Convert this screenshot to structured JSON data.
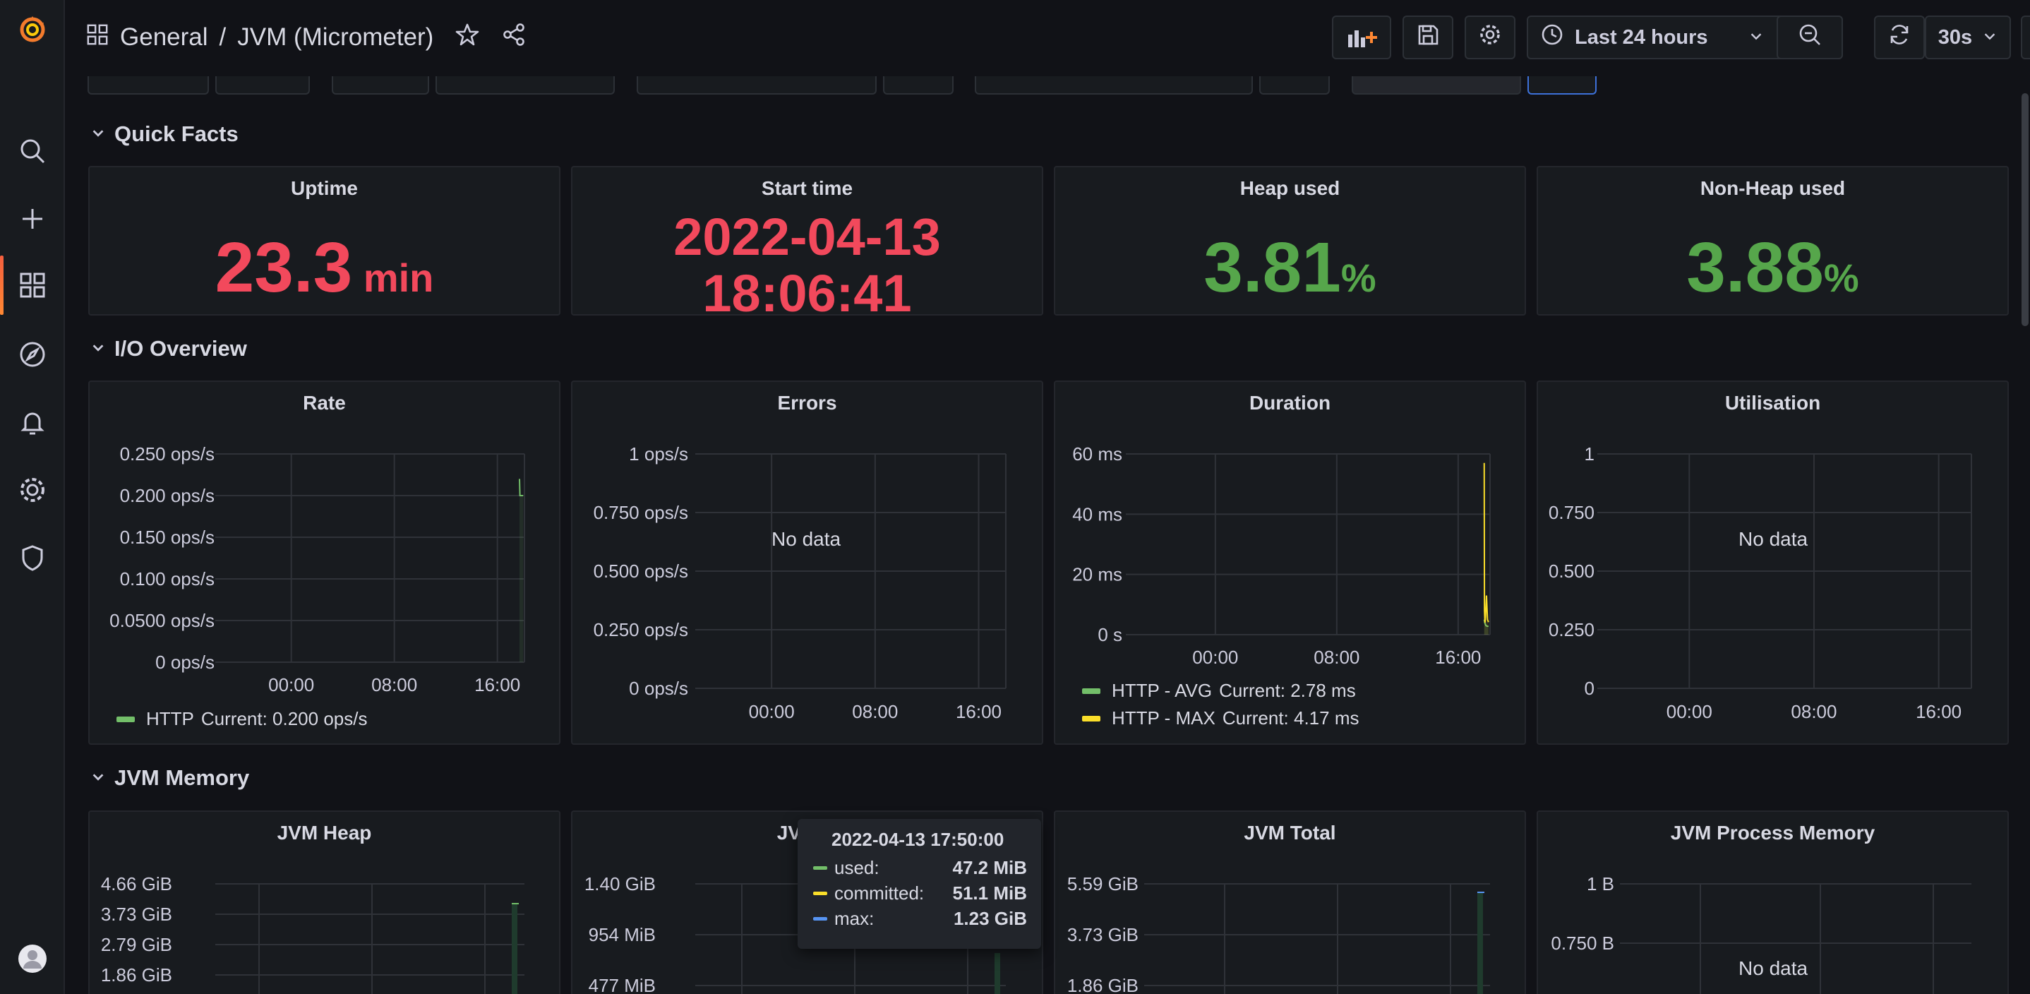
{
  "breadcrumb": {
    "folder": "General",
    "separator": "/",
    "dashboard": "JVM (Micrometer)"
  },
  "toolbar": {
    "time_range": "Last 24 hours",
    "refresh_interval": "30s"
  },
  "sidebar": {
    "items": [
      "grafana-logo-icon",
      "search-icon",
      "plus-icon",
      "dashboards-icon",
      "explore-icon",
      "alerting-icon",
      "gear-icon",
      "shield-icon",
      "user-avatar"
    ],
    "active": "dashboards-icon"
  },
  "rows": {
    "quick_facts": "Quick Facts",
    "io_overview": "I/O Overview",
    "jvm_memory": "JVM Memory"
  },
  "stats": {
    "uptime": {
      "title": "Uptime",
      "value": "23.3",
      "unit": "min",
      "color": "#f2495c"
    },
    "start_time": {
      "title": "Start time",
      "line1": "2022-04-13",
      "line2": "18:06:41",
      "color": "#f2495c"
    },
    "heap_used": {
      "title": "Heap used",
      "value": "3.81",
      "unit": "%",
      "color": "#56a64b"
    },
    "nonheap_used": {
      "title": "Non-Heap used",
      "value": "3.88",
      "unit": "%",
      "color": "#56a64b"
    }
  },
  "panels": {
    "rate": {
      "title": "Rate",
      "legend": [
        {
          "name": "HTTP",
          "text": "Current: 0.200 ops/s",
          "color": "#73bf69"
        }
      ]
    },
    "errors": {
      "title": "Errors",
      "no_data": "No data"
    },
    "duration": {
      "title": "Duration",
      "legend": [
        {
          "name": "HTTP - AVG",
          "text": "Current: 2.78 ms",
          "color": "#73bf69"
        },
        {
          "name": "HTTP - MAX",
          "text": "Current: 4.17 ms",
          "color": "#fade2a"
        }
      ]
    },
    "utilisation": {
      "title": "Utilisation",
      "no_data": "No data"
    },
    "jvm_heap": {
      "title": "JVM Heap"
    },
    "jvm_nonheap": {
      "title": "JVM N"
    },
    "jvm_total": {
      "title": "JVM Total"
    },
    "jvm_process": {
      "title": "JVM Process Memory",
      "no_data": "No data"
    }
  },
  "tooltip": {
    "time": "2022-04-13 17:50:00",
    "rows": [
      {
        "label": "used:",
        "value": "47.2 MiB",
        "color": "#73bf69"
      },
      {
        "label": "committed:",
        "value": "51.1 MiB",
        "color": "#fade2a"
      },
      {
        "label": "max:",
        "value": "1.23 GiB",
        "color": "#5794f2"
      }
    ]
  },
  "chart_data": [
    {
      "panel": "Rate",
      "type": "line",
      "x_ticks": [
        "00:00",
        "08:00",
        "16:00"
      ],
      "y_ticks": [
        "0.250 ops/s",
        "0.200 ops/s",
        "0.150 ops/s",
        "0.100 ops/s",
        "0.0500 ops/s",
        "0 ops/s"
      ],
      "ylim": [
        0,
        0.25
      ],
      "series": [
        {
          "name": "HTTP",
          "color": "#73bf69",
          "x": [
            "17:43",
            "17:45",
            "17:50",
            "18:00"
          ],
          "y": [
            0.22,
            0.2,
            0.2,
            0.2
          ]
        }
      ]
    },
    {
      "panel": "Errors",
      "type": "line",
      "x_ticks": [
        "00:00",
        "08:00",
        "16:00"
      ],
      "y_ticks": [
        "1 ops/s",
        "0.750 ops/s",
        "0.500 ops/s",
        "0.250 ops/s",
        "0 ops/s"
      ],
      "ylim": [
        0,
        1
      ],
      "series": []
    },
    {
      "panel": "Duration",
      "type": "line",
      "x_ticks": [
        "00:00",
        "08:00",
        "16:00"
      ],
      "y_ticks": [
        "60 ms",
        "40 ms",
        "20 ms",
        "0 s"
      ],
      "ylim": [
        0,
        60
      ],
      "series": [
        {
          "name": "HTTP - AVG",
          "color": "#73bf69",
          "x": [
            "17:43",
            "17:45",
            "17:50",
            "17:55",
            "18:00"
          ],
          "y": [
            5,
            4,
            3,
            2.8,
            2.78
          ]
        },
        {
          "name": "HTTP - MAX",
          "color": "#fade2a",
          "x": [
            "17:43",
            "17:44",
            "17:46",
            "17:48",
            "17:52",
            "17:56",
            "18:00"
          ],
          "y": [
            57,
            8,
            4,
            6,
            13,
            5,
            4.17
          ]
        }
      ]
    },
    {
      "panel": "Utilisation",
      "type": "line",
      "x_ticks": [
        "00:00",
        "08:00",
        "16:00"
      ],
      "y_ticks": [
        "1",
        "0.750",
        "0.500",
        "0.250",
        "0"
      ],
      "ylim": [
        0,
        1
      ],
      "series": []
    },
    {
      "panel": "JVM Heap",
      "type": "area",
      "y_ticks": [
        "4.66 GiB",
        "3.73 GiB",
        "2.79 GiB",
        "1.86 GiB"
      ]
    },
    {
      "panel": "JVM Non-Heap",
      "type": "area",
      "y_ticks": [
        "1.40 GiB",
        "954 MiB",
        "477 MiB"
      ]
    },
    {
      "panel": "JVM Total",
      "type": "area",
      "y_ticks": [
        "5.59 GiB",
        "3.73 GiB",
        "1.86 GiB"
      ]
    },
    {
      "panel": "JVM Process Memory",
      "type": "line",
      "y_ticks": [
        "1 B",
        "0.750 B"
      ],
      "series": []
    }
  ]
}
